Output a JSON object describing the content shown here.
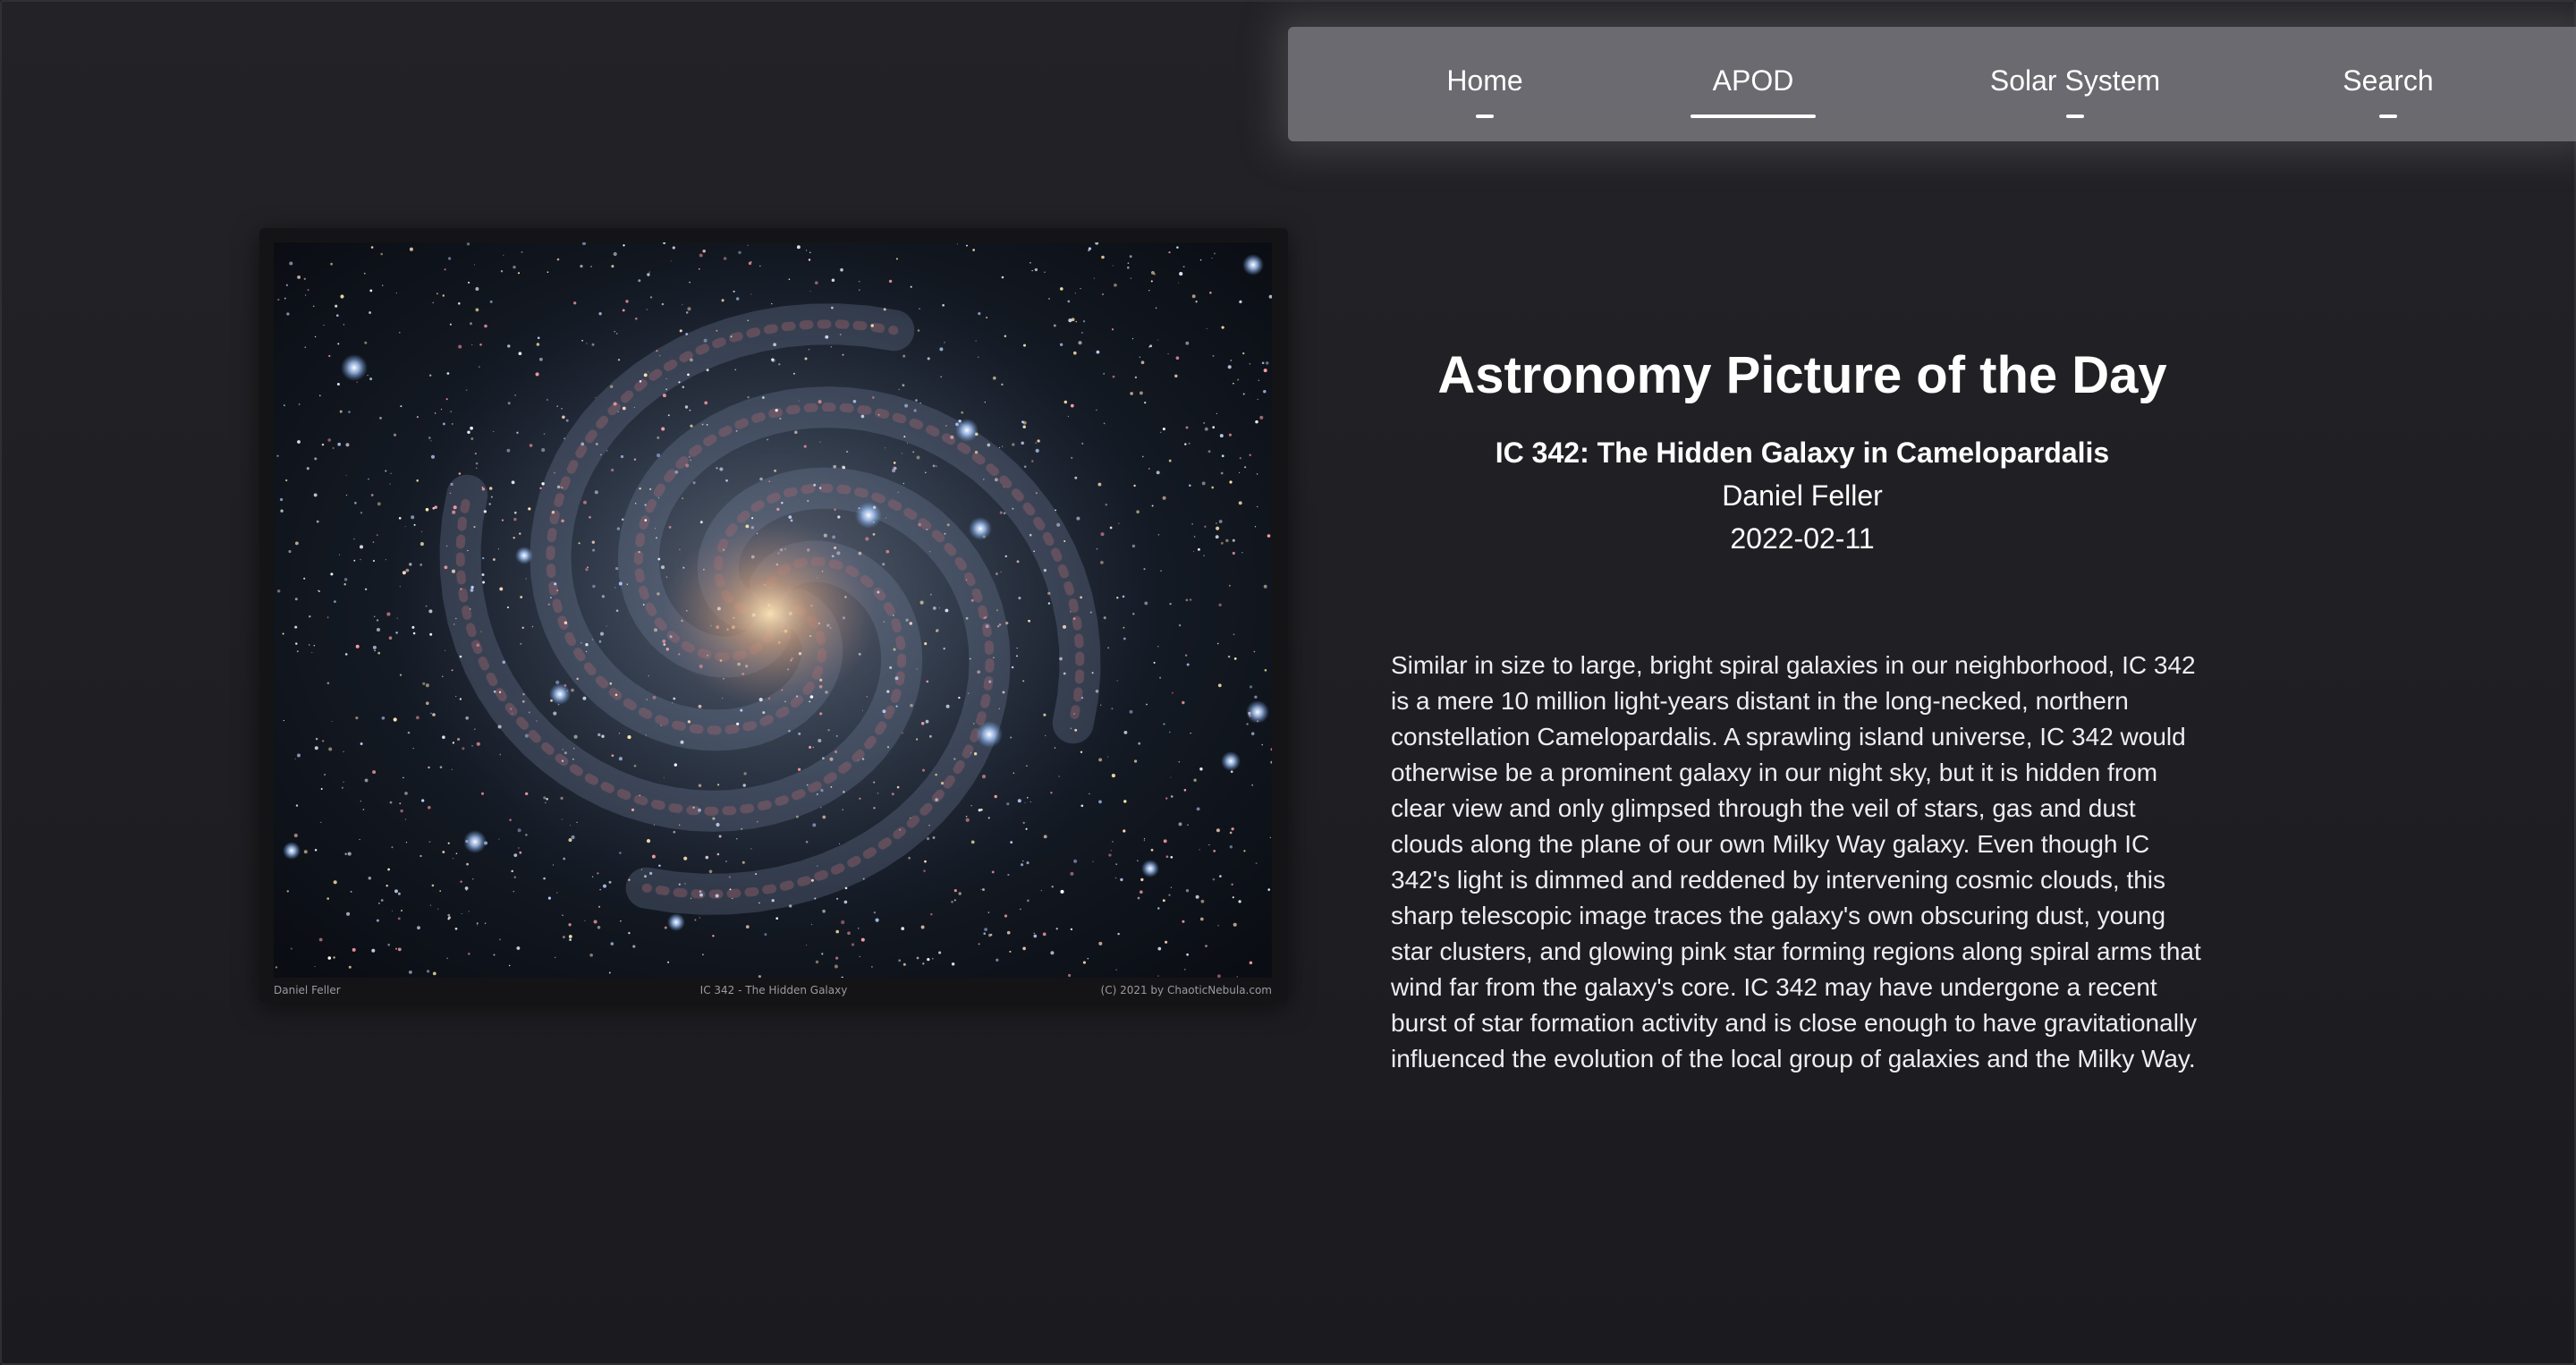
{
  "nav": {
    "items": [
      {
        "label": "Home",
        "active": false
      },
      {
        "label": "APOD",
        "active": true
      },
      {
        "label": "Solar System",
        "active": false
      },
      {
        "label": "Search",
        "active": false
      }
    ]
  },
  "page": {
    "title": "Astronomy Picture of the Day"
  },
  "apod": {
    "title": "IC 342: The Hidden Galaxy in Camelopardalis",
    "author": "Daniel Feller",
    "date": "2022-02-11",
    "explanation": "Similar in size to large, bright spiral galaxies in our neighborhood, IC 342 is a mere 10 million light-years distant in the long-necked, northern constellation Camelopardalis. A sprawling island universe, IC 342 would otherwise be a prominent galaxy in our night sky, but it is hidden from clear view and only glimpsed through the veil of stars, gas and dust clouds along the plane of our own Milky Way galaxy. Even though IC 342's light is dimmed and reddened by intervening cosmic clouds, this sharp telescopic image traces the galaxy's own obscuring dust, young star clusters, and glowing pink star forming regions along spiral arms that wind far from the galaxy's core. IC 342 may have undergone a recent burst of star formation activity and is close enough to have gravitationally influenced the evolution of the local group of galaxies and the Milky Way.",
    "image_caption": {
      "left": "Daniel Feller",
      "center": "IC 342 - The Hidden Galaxy",
      "right": "(C) 2021 by ChaoticNebula.com"
    }
  },
  "colors": {
    "background": "#1f1f23",
    "nav_background": "#7a7a80",
    "text": "#ffffff"
  }
}
